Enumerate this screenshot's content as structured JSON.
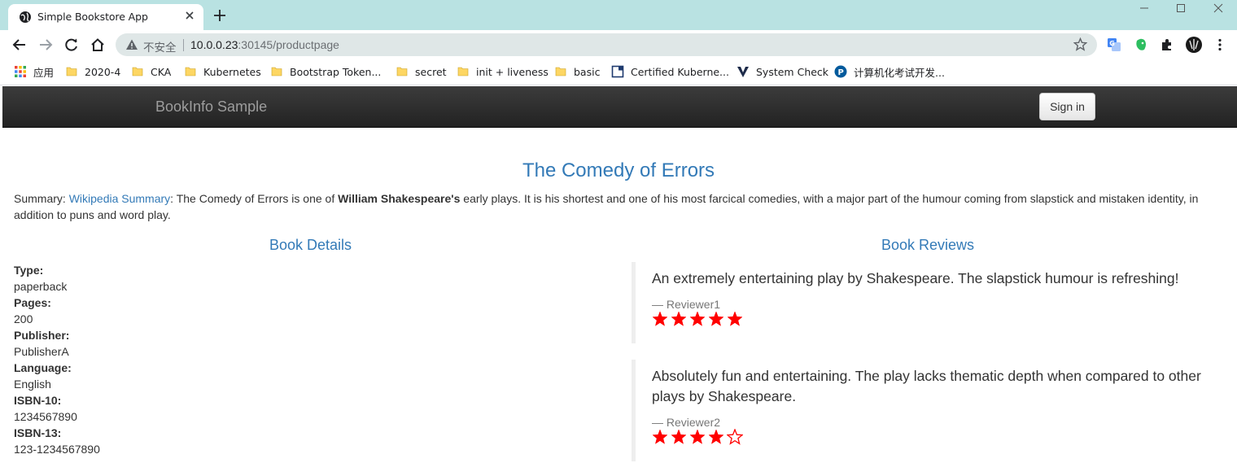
{
  "browser": {
    "tab_title": "Simple Bookstore App",
    "insecure_label": "不安全",
    "url_host": "10.0.0.23",
    "url_path": ":30145/productpage",
    "bookmarks": [
      {
        "label": "应用",
        "icon": "apps-grid-icon"
      },
      {
        "label": "2020-4",
        "icon": "folder-icon"
      },
      {
        "label": "CKA",
        "icon": "folder-icon"
      },
      {
        "label": "Kubernetes",
        "icon": "folder-icon"
      },
      {
        "label": "Bootstrap Token...",
        "icon": "folder-icon"
      },
      {
        "label": "secret",
        "icon": "folder-icon"
      },
      {
        "label": "init + liveness",
        "icon": "folder-icon"
      },
      {
        "label": "basic",
        "icon": "folder-icon"
      },
      {
        "label": "Certified Kuberne...",
        "icon": "page-icon"
      },
      {
        "label": "System Check",
        "icon": "v-logo-icon"
      },
      {
        "label": "计算机化考试开发...",
        "icon": "p-logo-icon"
      }
    ]
  },
  "navbar": {
    "brand": "BookInfo Sample",
    "signin_label": "Sign in"
  },
  "book": {
    "title": "The Comedy of Errors",
    "summary_prefix": "Summary: ",
    "summary_link": "Wikipedia Summary",
    "summary_text1": ": The Comedy of Errors is one of ",
    "summary_bold": "William Shakespeare's",
    "summary_text2": " early plays. It is his shortest and one of his most farcical comedies, with a major part of the humour coming from slapstick and mistaken identity, in addition to puns and word play."
  },
  "details": {
    "heading": "Book Details",
    "type_label": "Type:",
    "type_value": "paperback",
    "pages_label": "Pages:",
    "pages_value": "200",
    "publisher_label": "Publisher:",
    "publisher_value": "PublisherA",
    "language_label": "Language:",
    "language_value": "English",
    "isbn10_label": "ISBN-10:",
    "isbn10_value": "1234567890",
    "isbn13_label": "ISBN-13:",
    "isbn13_value": "123-1234567890"
  },
  "reviews": {
    "heading": "Book Reviews",
    "items": [
      {
        "text": "An extremely entertaining play by Shakespeare. The slapstick humour is refreshing!",
        "reviewer": "— Reviewer1",
        "rating": 5,
        "max": 5,
        "star_color": "#ff0000"
      },
      {
        "text": "Absolutely fun and entertaining. The play lacks thematic depth when compared to other plays by Shakespeare.",
        "reviewer": "— Reviewer2",
        "rating": 4,
        "max": 5,
        "star_color": "#ff0000"
      }
    ]
  }
}
